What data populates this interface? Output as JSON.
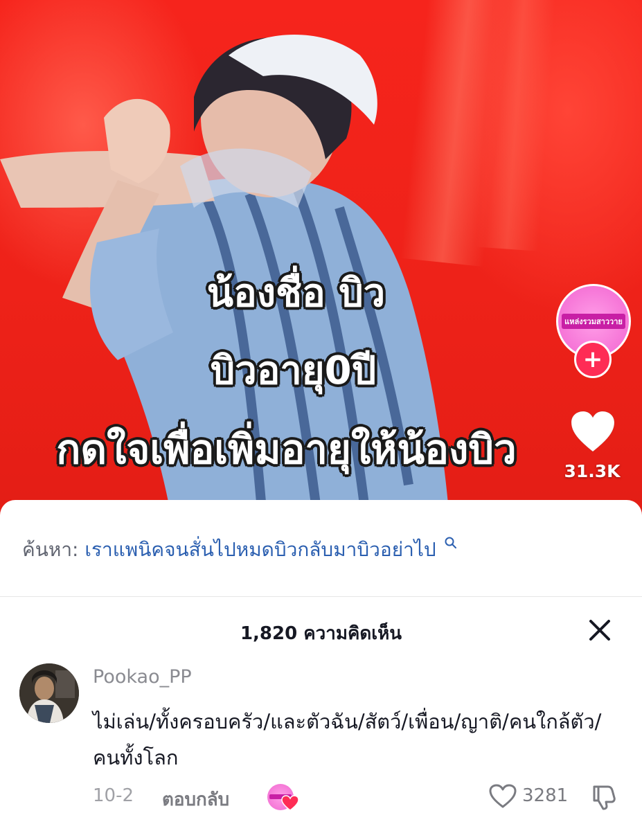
{
  "video": {
    "caption_line1": "น้องชื่อ บิว",
    "caption_line2": "บิวอายุ0ปี",
    "caption_line3": "กดใจเพื่อเพิ่มอายุให้น้องบิว",
    "creator_avatar_text": "แหล่งรวมสาววาย",
    "follow_label": "+",
    "like_count": "31.3K"
  },
  "search": {
    "prefix": "ค้นหา:",
    "query": "เราแพนิคจนสั่นไปหมดบิวกลับมาบิวอย่าไป"
  },
  "comments": {
    "title": "1,820 ความคิดเห็น",
    "items": [
      {
        "username": "Pookao_PP",
        "text": "ไม่เล่น/ทั้งครอบครัว/และตัวฉัน/สัตว์/เพื่อน/ญาติ/คนใกล้ตัว/คนทั้งโลก",
        "date": "10-2",
        "reply_label": "ตอบกลับ",
        "likes": "3281"
      }
    ]
  },
  "colors": {
    "video_red": "#ee2219",
    "follow_pink": "#fe2c55",
    "search_blue": "#2b5fb0",
    "text_dark": "#161823",
    "text_grey": "#8a8b91"
  },
  "icons": {
    "like": "heart-icon",
    "close": "close-icon",
    "search": "search-icon",
    "dislike": "thumbs-down-icon"
  }
}
